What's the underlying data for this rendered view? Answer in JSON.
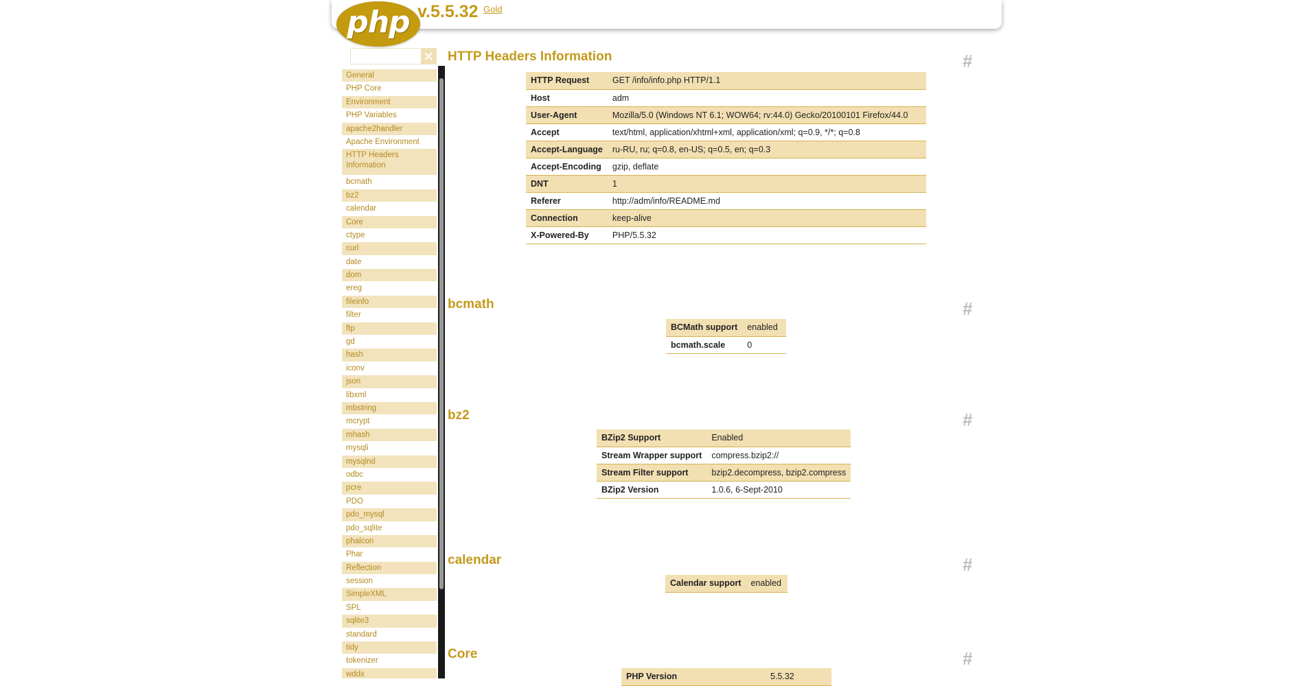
{
  "header": {
    "version": "v.5.5.32",
    "theme_link": "Gold",
    "logo_text": "php"
  },
  "search": {
    "placeholder": "",
    "value": ""
  },
  "sidebar": {
    "items": [
      {
        "label": "General"
      },
      {
        "label": "PHP Core"
      },
      {
        "label": "Environment"
      },
      {
        "label": "PHP Variables"
      },
      {
        "label": "apache2handler"
      },
      {
        "label": "Apache Environment"
      },
      {
        "label": "HTTP Headers Information"
      },
      {
        "label": "bcmath"
      },
      {
        "label": "bz2"
      },
      {
        "label": "calendar"
      },
      {
        "label": "Core"
      },
      {
        "label": "ctype"
      },
      {
        "label": "curl"
      },
      {
        "label": "date"
      },
      {
        "label": "dom"
      },
      {
        "label": "ereg"
      },
      {
        "label": "fileinfo"
      },
      {
        "label": "filter"
      },
      {
        "label": "ftp"
      },
      {
        "label": "gd"
      },
      {
        "label": "hash"
      },
      {
        "label": "iconv"
      },
      {
        "label": "json"
      },
      {
        "label": "libxml"
      },
      {
        "label": "mbstring"
      },
      {
        "label": "mcrypt"
      },
      {
        "label": "mhash"
      },
      {
        "label": "mysqli"
      },
      {
        "label": "mysqlnd"
      },
      {
        "label": "odbc"
      },
      {
        "label": "pcre"
      },
      {
        "label": "PDO"
      },
      {
        "label": "pdo_mysql"
      },
      {
        "label": "pdo_sqlite"
      },
      {
        "label": "phalcon"
      },
      {
        "label": "Phar"
      },
      {
        "label": "Reflection"
      },
      {
        "label": "session"
      },
      {
        "label": "SimpleXML"
      },
      {
        "label": "SPL"
      },
      {
        "label": "sqlite3"
      },
      {
        "label": "standard"
      },
      {
        "label": "tidy"
      },
      {
        "label": "tokenizer"
      },
      {
        "label": "wddx"
      }
    ]
  },
  "anchor_symbol": "#",
  "sections": [
    {
      "title": "HTTP Headers Information",
      "rows": [
        [
          "HTTP Request",
          "GET /info/info.php HTTP/1.1"
        ],
        [
          "Host",
          "adm"
        ],
        [
          "User-Agent",
          "Mozilla/5.0 (Windows NT 6.1; WOW64; rv:44.0) Gecko/20100101 Firefox/44.0"
        ],
        [
          "Accept",
          "text/html, application/xhtml+xml, application/xml; q=0.9, */*; q=0.8"
        ],
        [
          "Accept-Language",
          "ru-RU, ru; q=0.8, en-US; q=0.5, en; q=0.3"
        ],
        [
          "Accept-Encoding",
          "gzip, deflate"
        ],
        [
          "DNT",
          "1"
        ],
        [
          "Referer",
          "http://adm/info/README.md"
        ],
        [
          "Connection",
          "keep-alive"
        ],
        [
          "X-Powered-By",
          "PHP/5.5.32"
        ]
      ]
    },
    {
      "title": "bcmath",
      "rows": [
        [
          "BCMath support",
          "enabled"
        ],
        [
          "bcmath.scale",
          "0"
        ]
      ]
    },
    {
      "title": "bz2",
      "rows": [
        [
          "BZip2 Support",
          "Enabled"
        ],
        [
          "Stream Wrapper support",
          "compress.bzip2://"
        ],
        [
          "Stream Filter support",
          "bzip2.decompress, bzip2.compress"
        ],
        [
          "BZip2 Version",
          "1.0.6, 6-Sept-2010"
        ]
      ]
    },
    {
      "title": "calendar",
      "rows": [
        [
          "Calendar support",
          "enabled"
        ]
      ]
    },
    {
      "title": "Core",
      "rows": [
        [
          "PHP Version",
          "5.5.32"
        ]
      ]
    }
  ],
  "colors": {
    "accent": "#c49a1b",
    "row_highlight": "#f2e0b3",
    "row_border": "#d4b14a",
    "scrollbar_track": "#1a1a1a"
  }
}
